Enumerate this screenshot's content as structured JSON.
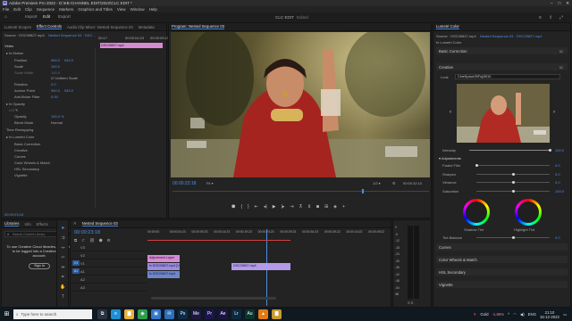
{
  "window": {
    "title": "Adobe Premiere Pro 2022 - D:\\KB CHANNEL EDIT\\2022\\CLC EDIT *",
    "app_icon": "Pr",
    "controls": [
      "–",
      "□",
      "✕"
    ]
  },
  "menubar": {
    "items": [
      "File",
      "Edit",
      "Clip",
      "Sequence",
      "Markers",
      "Graphics and Titles",
      "View",
      "Window",
      "Help"
    ]
  },
  "workspaces": {
    "home_icon": "home-icon",
    "tabs": [
      "Import",
      "Edit",
      "Export"
    ],
    "active_tab": "Edit",
    "project_name": "CLC EDIT",
    "project_status": "Edited"
  },
  "left_panel": {
    "tabs": [
      "Lumetri Scopes",
      "Effect Controls",
      "Audio Clip Mixer: Nested Sequence 03",
      "Metadata"
    ],
    "source_label": "Source · DSC09827.mp4",
    "sequence_label": "Nested Sequence 03 · DSC...",
    "mini_ruler": [
      "00:17",
      "00:00:04:23",
      "00:00:09:23"
    ],
    "clip_chip": "DSC09827.mp4",
    "video_label": "Video",
    "motion": {
      "header": "Motion",
      "rows": [
        {
          "label": "Position",
          "value": "960.0",
          "value2": "540.0"
        },
        {
          "label": "Scale",
          "value": "100.0",
          "value2": ""
        },
        {
          "label": "Scale Width",
          "value": "100.0",
          "value2": ""
        },
        {
          "label": "Uniform Scale",
          "value": "",
          "value2": ""
        },
        {
          "label": "Rotation",
          "value": "0.0",
          "value2": ""
        },
        {
          "label": "Anchor Point",
          "value": "960.0",
          "value2": "540.0"
        },
        {
          "label": "Anti-flicker Filter",
          "value": "0.00",
          "value2": ""
        }
      ]
    },
    "opacity": {
      "header": "Opacity",
      "rows": [
        {
          "label": "Opacity",
          "value": "100.0 %"
        },
        {
          "label": "Blend Mode",
          "value": "Normal"
        }
      ]
    },
    "time_remapping": "Time Remapping",
    "lumetri_sub": {
      "header": "Lumetri Color",
      "items": [
        "Basic Correction",
        "Creative",
        "Curves",
        "Color Wheels & Match",
        "HSL Secondary",
        "Vignette"
      ]
    },
    "timecode": "00:00:23:18"
  },
  "program_monitor": {
    "tab": "Program: Nested Sequence 03",
    "timecode": "00:00:23:18",
    "fit": "Fit",
    "resolution": "1/2",
    "duration": "00:00:32:10",
    "transport_icons": [
      "marker-icon",
      "in-icon",
      "out-icon",
      "go-in-icon",
      "step-back-icon",
      "play-icon",
      "step-forward-icon",
      "go-out-icon",
      "lift-icon",
      "extract-icon",
      "export-frame-icon",
      "compare-icon",
      "vr-icon",
      "add-button-icon"
    ]
  },
  "lumetri_panel": {
    "tab": "Lumetri Color",
    "source_label": "Source · DSC09827.mp4",
    "sequence_label": "Nested Sequence 03 · DSC09827.mp4",
    "fx_label": "fx  Lumetri Color",
    "basic_correction": "Basic Correction",
    "creative": {
      "header": "Creative",
      "look_label": "Look",
      "look_value": "CineSpace25Fuji3510",
      "intensity_label": "Intensity",
      "intensity_value": "100.0",
      "intensity_fraction": 1.0,
      "adjustments_label": "Adjustments",
      "sliders": [
        {
          "label": "Faded Film",
          "value": "0.0",
          "fraction": 0.0
        },
        {
          "label": "Sharpen",
          "value": "0.0",
          "fraction": 0.5
        },
        {
          "label": "Vibrance",
          "value": "0.0",
          "fraction": 0.5
        },
        {
          "label": "Saturation",
          "value": "100.0",
          "fraction": 0.5
        }
      ],
      "shadow_tint_label": "Shadow Tint",
      "highlight_tint_label": "Highlight Tint",
      "tint_balance_label": "Tint Balance",
      "tint_balance_value": "0.0"
    },
    "sections": [
      "Curves",
      "Color Wheels & Match",
      "HSL Secondary",
      "Vignette"
    ]
  },
  "project_panel": {
    "tabs": [
      "Libraries",
      "Info",
      "Effects"
    ],
    "search_placeholder": "Search Current Library",
    "message_line1": "To use Creative Cloud libraries, you need",
    "message_line2": "to be logged into a Creative Cloud",
    "message_line3": "account.",
    "sign_in": "Sign In"
  },
  "timeline": {
    "tab": "Nested Sequence 03",
    "timecode": "00:00:23:18",
    "ruler": [
      "00:00:00",
      "00:00:04:23",
      "00:00:09:23",
      "00:00:14:23",
      "00:00:19:23",
      "00:00:24:23",
      "00:00:29:23",
      "00:00:34:23",
      "00:00:39:22",
      "00:00:44:22",
      "00:00:49:22"
    ],
    "playhead_fraction": 0.49,
    "tracks": [
      {
        "target": "V3",
        "name": "V3"
      },
      {
        "target": "V2",
        "name": "V2"
      },
      {
        "target": "V1",
        "name": "V1"
      },
      {
        "target": "A1",
        "name": "A1"
      },
      {
        "target": "A2",
        "name": "A2"
      },
      {
        "target": "A3",
        "name": "A3"
      }
    ],
    "clips": [
      {
        "label": "Adjustment Layer",
        "track": "V3",
        "color": "#d58bd3"
      },
      {
        "label": "fx DSC09827.mp4 [V]",
        "track": "V2",
        "color": "#9a8de0"
      },
      {
        "label": "fx DSC09827.mp4",
        "track": "V1",
        "color": "#6e86c9"
      },
      {
        "label": "DSC09827.mp4",
        "track": "V1b",
        "color": "#b39be8"
      }
    ]
  },
  "audio_meter": {
    "labels": [
      "0",
      "-6",
      "-12",
      "-18",
      "-24",
      "-30",
      "-36",
      "-42",
      "-48",
      "-54",
      "dB"
    ],
    "footer": "S  S"
  },
  "tools": [
    "selection-tool-icon",
    "track-select-icon",
    "ripple-edit-icon",
    "razor-tool-icon",
    "slip-tool-icon",
    "pen-tool-icon",
    "hand-tool-icon",
    "type-tool-icon"
  ],
  "taskbar": {
    "search_placeholder": "Type here to search",
    "apps": [
      {
        "icon": "task-view-icon",
        "glyph": "⧉",
        "color": "#2a3440"
      },
      {
        "icon": "edge-icon",
        "glyph": "e",
        "color": "#1d8fd4"
      },
      {
        "icon": "explorer-icon",
        "glyph": "▇",
        "color": "#e3b341"
      },
      {
        "icon": "chrome-icon",
        "glyph": "◉",
        "color": "#2e9d4c"
      },
      {
        "icon": "store-icon",
        "glyph": "▣",
        "color": "#3577c8"
      },
      {
        "icon": "mail-icon",
        "glyph": "✉",
        "color": "#2c6fb8"
      },
      {
        "icon": "photoshop-icon",
        "glyph": "Ps",
        "color": "#0e2a46"
      },
      {
        "icon": "media-encoder-icon",
        "glyph": "Me",
        "color": "#1d1840"
      },
      {
        "icon": "premiere-icon",
        "glyph": "Pr",
        "color": "#1b1550"
      },
      {
        "icon": "after-effects-icon",
        "glyph": "Ae",
        "color": "#1c1445"
      },
      {
        "icon": "lightroom-icon",
        "glyph": "Lr",
        "color": "#0b2a3f"
      },
      {
        "icon": "audition-icon",
        "glyph": "Au",
        "color": "#09352f"
      },
      {
        "icon": "vlc-icon",
        "glyph": "▲",
        "color": "#e57a12"
      },
      {
        "icon": "folder-icon",
        "glyph": "▇",
        "color": "#c79a2e"
      }
    ],
    "ticker": "Gold",
    "ticker_change": "-1.86%",
    "language": "ENG",
    "time": "21:10",
    "date": "15-12-2022"
  },
  "colors": {
    "accent": "#3d7cd8",
    "value_blue": "#4f8fe6",
    "playhead": "#4a90e2"
  }
}
